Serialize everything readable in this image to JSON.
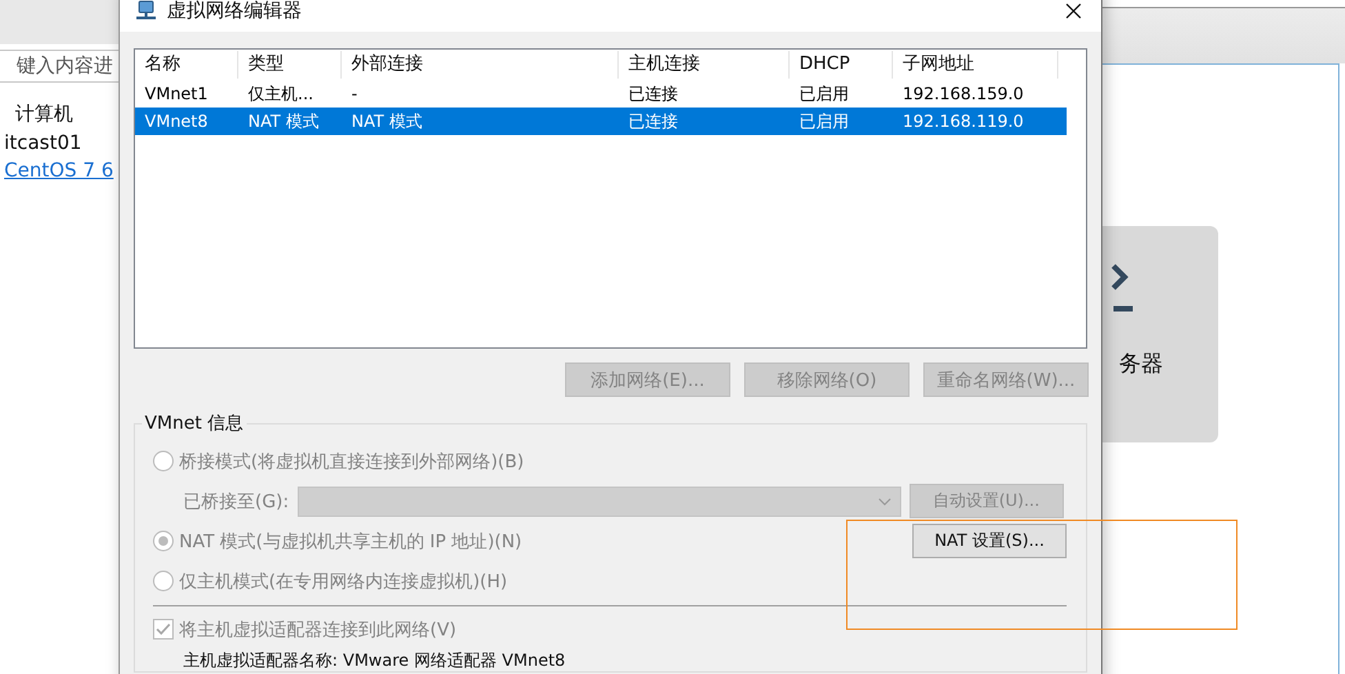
{
  "background_app": {
    "search_placeholder": "键入内容进",
    "tree": [
      {
        "label": "计算机",
        "children": [
          {
            "label": "itcast01",
            "kind": "text"
          },
          {
            "label": "CentOS 7 6",
            "kind": "link"
          }
        ]
      }
    ],
    "card_label": "务器"
  },
  "dialog": {
    "title": "虚拟网络编辑器",
    "columns": [
      "名称",
      "类型",
      "外部连接",
      "主机连接",
      "DHCP",
      "子网地址"
    ],
    "rows": [
      {
        "cells": [
          "VMnet1",
          "仅主机...",
          "-",
          "已连接",
          "已启用",
          "192.168.159.0"
        ],
        "selected": false
      },
      {
        "cells": [
          "VMnet8",
          "NAT 模式",
          "NAT 模式",
          "已连接",
          "已启用",
          "192.168.119.0"
        ],
        "selected": true
      }
    ],
    "list_buttons": [
      {
        "label": "添加网络(E)...",
        "disabled": true
      },
      {
        "label": "移除网络(O)",
        "disabled": true
      },
      {
        "label": "重命名网络(W)...",
        "disabled": true
      }
    ],
    "group_title": "VMnet 信息",
    "options": [
      {
        "kind": "radio",
        "label": "桥接模式(将虚拟机直接连接到外部网络)(B)",
        "selected": false,
        "disabled": true
      },
      {
        "kind": "bridge",
        "label": "已桥接至(G):",
        "disabled": true,
        "button": {
          "label": "自动设置(U)...",
          "disabled": true
        }
      },
      {
        "kind": "radio",
        "label": "NAT 模式(与虚拟机共享主机的 IP 地址)(N)",
        "selected": true,
        "disabled": true,
        "button": {
          "label": "NAT 设置(S)...",
          "disabled": false
        }
      },
      {
        "kind": "radio",
        "label": "仅主机模式(在专用网络内连接虚拟机)(H)",
        "selected": false,
        "disabled": true
      },
      {
        "kind": "separator"
      },
      {
        "kind": "checkbox",
        "label": "将主机虚拟适配器连接到此网络(V)",
        "checked": true,
        "disabled": true
      },
      {
        "kind": "text",
        "label": "主机虚拟适配器名称: VMware 网络适配器 VMnet8"
      }
    ]
  }
}
